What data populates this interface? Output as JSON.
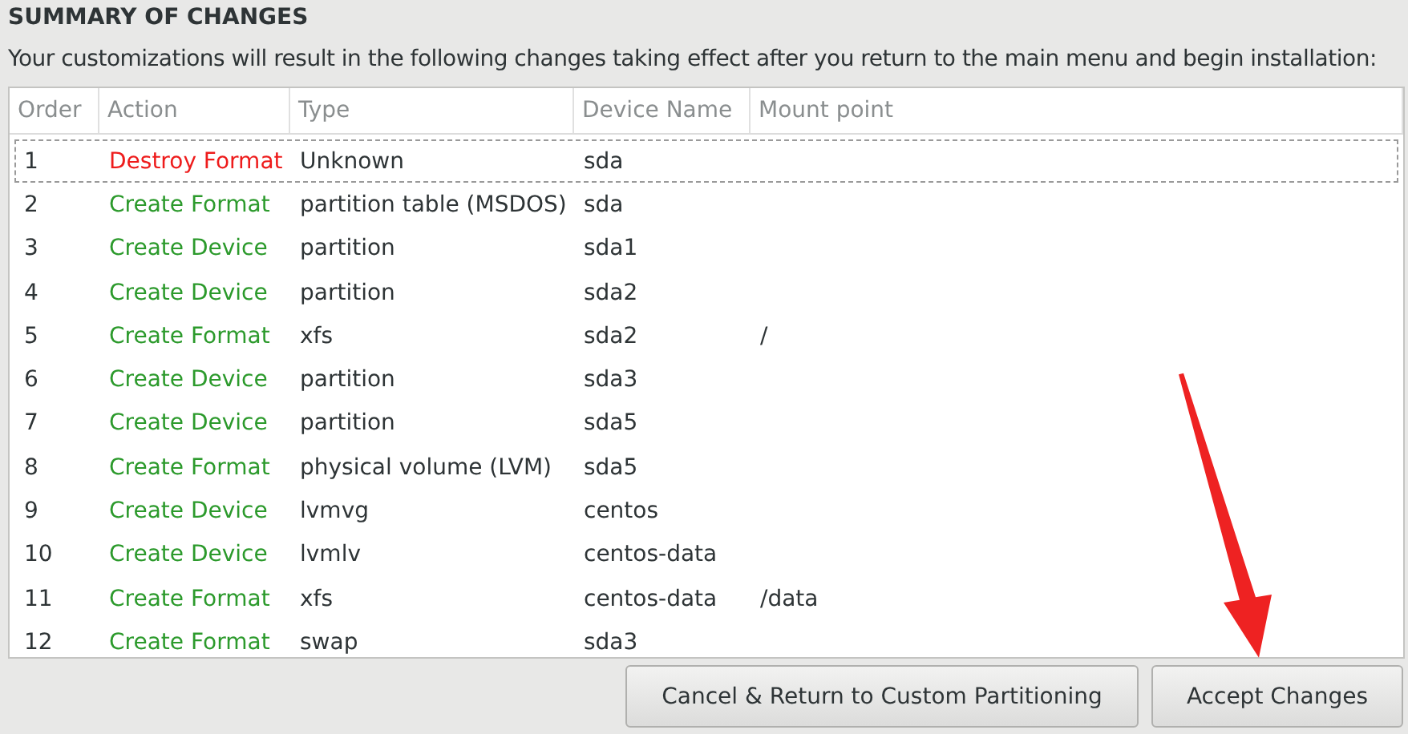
{
  "title": "SUMMARY OF CHANGES",
  "description": "Your customizations will result in the following changes taking effect after you return to the main menu and begin installation:",
  "table": {
    "columns": [
      "Order",
      "Action",
      "Type",
      "Device Name",
      "Mount point"
    ],
    "rows": [
      {
        "order": "1",
        "action": "Destroy Format",
        "kind": "destroy",
        "type": "Unknown",
        "device": "sda",
        "mount": "",
        "selected": true
      },
      {
        "order": "2",
        "action": "Create Format",
        "kind": "create",
        "type": "partition table (MSDOS)",
        "device": "sda",
        "mount": "",
        "selected": false
      },
      {
        "order": "3",
        "action": "Create Device",
        "kind": "create",
        "type": "partition",
        "device": "sda1",
        "mount": "",
        "selected": false
      },
      {
        "order": "4",
        "action": "Create Device",
        "kind": "create",
        "type": "partition",
        "device": "sda2",
        "mount": "",
        "selected": false
      },
      {
        "order": "5",
        "action": "Create Format",
        "kind": "create",
        "type": "xfs",
        "device": "sda2",
        "mount": "/",
        "selected": false
      },
      {
        "order": "6",
        "action": "Create Device",
        "kind": "create",
        "type": "partition",
        "device": "sda3",
        "mount": "",
        "selected": false
      },
      {
        "order": "7",
        "action": "Create Device",
        "kind": "create",
        "type": "partition",
        "device": "sda5",
        "mount": "",
        "selected": false
      },
      {
        "order": "8",
        "action": "Create Format",
        "kind": "create",
        "type": "physical volume (LVM)",
        "device": "sda5",
        "mount": "",
        "selected": false
      },
      {
        "order": "9",
        "action": "Create Device",
        "kind": "create",
        "type": "lvmvg",
        "device": "centos",
        "mount": "",
        "selected": false
      },
      {
        "order": "10",
        "action": "Create Device",
        "kind": "create",
        "type": "lvmlv",
        "device": "centos-data",
        "mount": "",
        "selected": false
      },
      {
        "order": "11",
        "action": "Create Format",
        "kind": "create",
        "type": "xfs",
        "device": "centos-data",
        "mount": "/data",
        "selected": false
      },
      {
        "order": "12",
        "action": "Create Format",
        "kind": "create",
        "type": "swap",
        "device": "sda3",
        "mount": "",
        "selected": false
      }
    ]
  },
  "buttons": [
    {
      "label": "Cancel & Return to Custom Partitioning"
    },
    {
      "label": "Accept Changes"
    }
  ]
}
